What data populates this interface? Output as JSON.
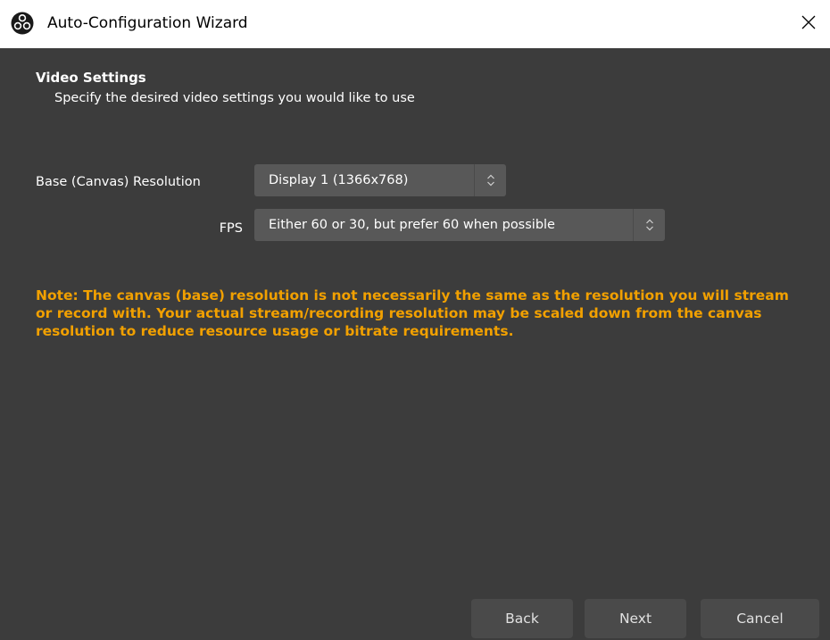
{
  "window": {
    "title": "Auto-Configuration Wizard",
    "app_icon": "obs-logo-icon",
    "close_icon": "close-icon"
  },
  "page": {
    "heading": "Video Settings",
    "subheading": "Specify the desired video settings you would like to use"
  },
  "form": {
    "resolution": {
      "label": "Base (Canvas) Resolution",
      "value": "Display 1 (1366x768)"
    },
    "fps": {
      "label": "FPS",
      "value": "Either 60 or 30, but prefer 60 when possible"
    }
  },
  "note": "Note: The canvas (base) resolution is not necessarily the same as the resolution you will stream or record with. Your actual stream/recording resolution may be scaled down from the canvas resolution to reduce resource usage or bitrate requirements.",
  "buttons": {
    "back": "Back",
    "next": "Next",
    "cancel": "Cancel"
  },
  "colors": {
    "content_bg": "#3c3c3c",
    "combo_bg": "#585858",
    "button_bg": "#4a4a4a",
    "note_color": "#f1a000"
  }
}
